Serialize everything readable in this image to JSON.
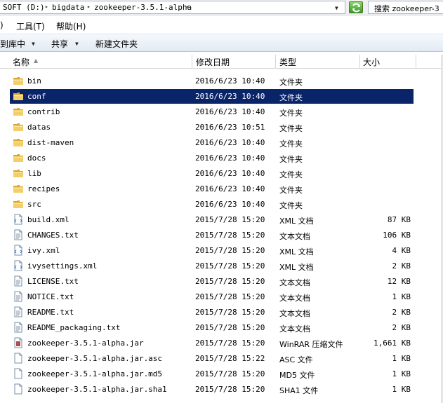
{
  "address": {
    "crumbs": [
      "SOFT (D:)",
      "bigdata",
      "zookeeper-3.5.1-alpha"
    ],
    "leading_sep": "▸",
    "search_placeholder": "搜索 zookeeper-3"
  },
  "menu": {
    "fragment": ")",
    "tools": "工具(T)",
    "help": "帮助(H)"
  },
  "toolbar": {
    "include_library": "到库中",
    "share": "共享",
    "new_folder": "新建文件夹"
  },
  "columns": {
    "name": "名称",
    "date": "修改日期",
    "type": "类型",
    "size": "大小"
  },
  "files": [
    {
      "name": "bin",
      "date": "2016/6/23 10:40",
      "type": "文件夹",
      "size": "",
      "icon": "folder-icon"
    },
    {
      "name": "conf",
      "date": "2016/6/23 10:40",
      "type": "文件夹",
      "size": "",
      "icon": "folder-icon",
      "selected": true
    },
    {
      "name": "contrib",
      "date": "2016/6/23 10:40",
      "type": "文件夹",
      "size": "",
      "icon": "folder-icon"
    },
    {
      "name": "datas",
      "date": "2016/6/23 10:51",
      "type": "文件夹",
      "size": "",
      "icon": "folder-icon"
    },
    {
      "name": "dist-maven",
      "date": "2016/6/23 10:40",
      "type": "文件夹",
      "size": "",
      "icon": "folder-icon"
    },
    {
      "name": "docs",
      "date": "2016/6/23 10:40",
      "type": "文件夹",
      "size": "",
      "icon": "folder-icon"
    },
    {
      "name": "lib",
      "date": "2016/6/23 10:40",
      "type": "文件夹",
      "size": "",
      "icon": "folder-icon"
    },
    {
      "name": "recipes",
      "date": "2016/6/23 10:40",
      "type": "文件夹",
      "size": "",
      "icon": "folder-icon"
    },
    {
      "name": "src",
      "date": "2016/6/23 10:40",
      "type": "文件夹",
      "size": "",
      "icon": "folder-icon"
    },
    {
      "name": "build.xml",
      "date": "2015/7/28 15:20",
      "type": "XML 文档",
      "size": "87 KB",
      "icon": "xml-file-icon"
    },
    {
      "name": "CHANGES.txt",
      "date": "2015/7/28 15:20",
      "type": "文本文档",
      "size": "106 KB",
      "icon": "text-file-icon"
    },
    {
      "name": "ivy.xml",
      "date": "2015/7/28 15:20",
      "type": "XML 文档",
      "size": "4 KB",
      "icon": "xml-file-icon"
    },
    {
      "name": "ivysettings.xml",
      "date": "2015/7/28 15:20",
      "type": "XML 文档",
      "size": "2 KB",
      "icon": "xml-file-icon"
    },
    {
      "name": "LICENSE.txt",
      "date": "2015/7/28 15:20",
      "type": "文本文档",
      "size": "12 KB",
      "icon": "text-file-icon"
    },
    {
      "name": "NOTICE.txt",
      "date": "2015/7/28 15:20",
      "type": "文本文档",
      "size": "1 KB",
      "icon": "text-file-icon"
    },
    {
      "name": "README.txt",
      "date": "2015/7/28 15:20",
      "type": "文本文档",
      "size": "2 KB",
      "icon": "text-file-icon"
    },
    {
      "name": "README_packaging.txt",
      "date": "2015/7/28 15:20",
      "type": "文本文档",
      "size": "2 KB",
      "icon": "text-file-icon"
    },
    {
      "name": "zookeeper-3.5.1-alpha.jar",
      "date": "2015/7/28 15:20",
      "type": "WinRAR 压缩文件",
      "size": "1,661 KB",
      "icon": "archive-file-icon"
    },
    {
      "name": "zookeeper-3.5.1-alpha.jar.asc",
      "date": "2015/7/28 15:22",
      "type": "ASC 文件",
      "size": "1 KB",
      "icon": "blank-file-icon"
    },
    {
      "name": "zookeeper-3.5.1-alpha.jar.md5",
      "date": "2015/7/28 15:20",
      "type": "MD5 文件",
      "size": "1 KB",
      "icon": "blank-file-icon"
    },
    {
      "name": "zookeeper-3.5.1-alpha.jar.sha1",
      "date": "2015/7/28 15:20",
      "type": "SHA1 文件",
      "size": "1 KB",
      "icon": "blank-file-icon"
    }
  ],
  "colors": {
    "selection": "#0a246a",
    "folder": "#e8c35a",
    "refresh": "#3a9a2a"
  }
}
